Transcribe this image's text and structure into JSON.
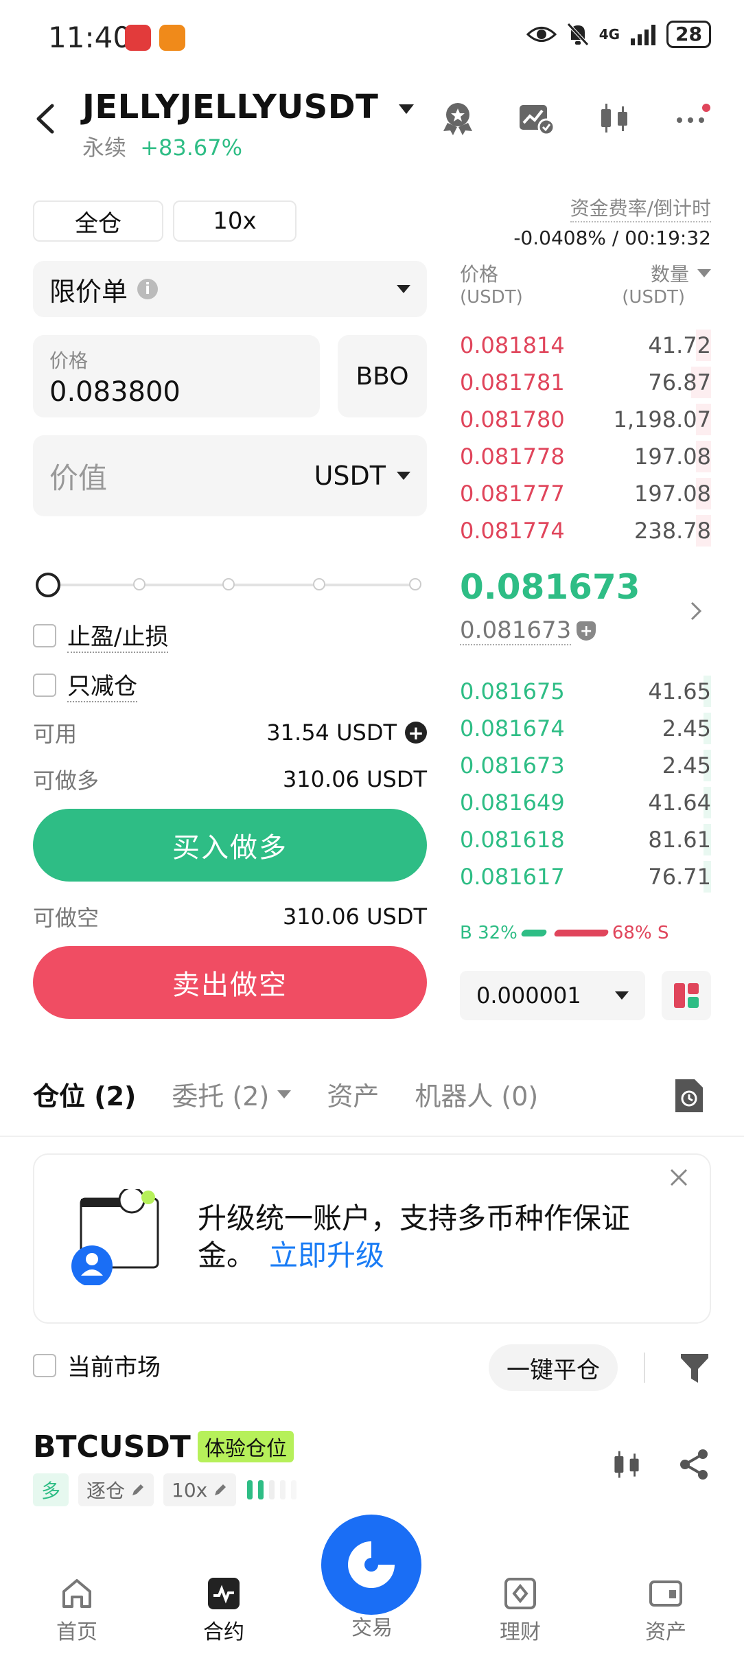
{
  "status_bar": {
    "time": "11:40",
    "network": "4G",
    "battery": "28"
  },
  "header": {
    "pair": "JELLYJELLYUSDT",
    "contract_type": "永续",
    "change": "+83.67%"
  },
  "mode": {
    "margin_mode": "全仓",
    "leverage": "10x"
  },
  "funding": {
    "label": "资金费率/倒计时",
    "value": "-0.0408% / 00:19:32"
  },
  "order_form": {
    "order_type": "限价单",
    "price_label": "价格",
    "price_value": "0.083800",
    "bbo_label": "BBO",
    "value_placeholder": "价值",
    "value_unit": "USDT",
    "slider_percent": 0,
    "tp_sl_label": "止盈/止损",
    "reduce_only_label": "只减仓",
    "available_label": "可用",
    "available_value": "31.54 USDT",
    "max_long_label": "可做多",
    "max_long_value": "310.06 USDT",
    "buy_label": "买入做多",
    "max_short_label": "可做空",
    "max_short_value": "310.06 USDT",
    "sell_label": "卖出做空"
  },
  "order_book": {
    "price_header": "价格",
    "price_unit": "(USDT)",
    "qty_header": "数量",
    "qty_unit": "(USDT)",
    "asks": [
      {
        "price": "0.081814",
        "qty": "41.72",
        "depth": 0.06
      },
      {
        "price": "0.081781",
        "qty": "76.87",
        "depth": 0.08
      },
      {
        "price": "0.081780",
        "qty": "1,198.07",
        "depth": 0.06
      },
      {
        "price": "0.081778",
        "qty": "197.08",
        "depth": 0.06
      },
      {
        "price": "0.081777",
        "qty": "197.08",
        "depth": 0.06
      },
      {
        "price": "0.081774",
        "qty": "238.78",
        "depth": 0.06
      }
    ],
    "last_price": "0.081673",
    "mark_price": "0.081673",
    "bids": [
      {
        "price": "0.081675",
        "qty": "41.65",
        "depth": 0.03
      },
      {
        "price": "0.081674",
        "qty": "2.45",
        "depth": 0.03
      },
      {
        "price": "0.081673",
        "qty": "2.45",
        "depth": 0.03
      },
      {
        "price": "0.081649",
        "qty": "41.64",
        "depth": 0.03
      },
      {
        "price": "0.081618",
        "qty": "81.61",
        "depth": 0.03
      },
      {
        "price": "0.081617",
        "qty": "76.71",
        "depth": 0.03
      }
    ],
    "buy_ratio_label": "B 32%",
    "sell_ratio_label": "68% S",
    "buy_ratio": 0.32,
    "precision": "0.000001"
  },
  "tabs": [
    {
      "label": "仓位 (2)"
    },
    {
      "label": "委托 (2)"
    },
    {
      "label": "资产"
    },
    {
      "label": "机器人 (0)"
    }
  ],
  "banner": {
    "text": "升级统一账户，支持多币种作保证金。",
    "link": "立即升级"
  },
  "positions_bar": {
    "current_market_label": "当前市场",
    "close_all_label": "一键平仓"
  },
  "position": {
    "symbol": "BTCUSDT",
    "badge": "体验仓位",
    "side": "多",
    "margin": "逐仓",
    "leverage": "10x"
  },
  "bottom_nav": [
    {
      "label": "首页"
    },
    {
      "label": "合约"
    },
    {
      "label": "交易"
    },
    {
      "label": "理财"
    },
    {
      "label": "资产"
    }
  ],
  "colors": {
    "green": "#2ebd85",
    "red": "#e0455b",
    "blue": "#1a6ef5",
    "badge": "#b6f05a"
  }
}
